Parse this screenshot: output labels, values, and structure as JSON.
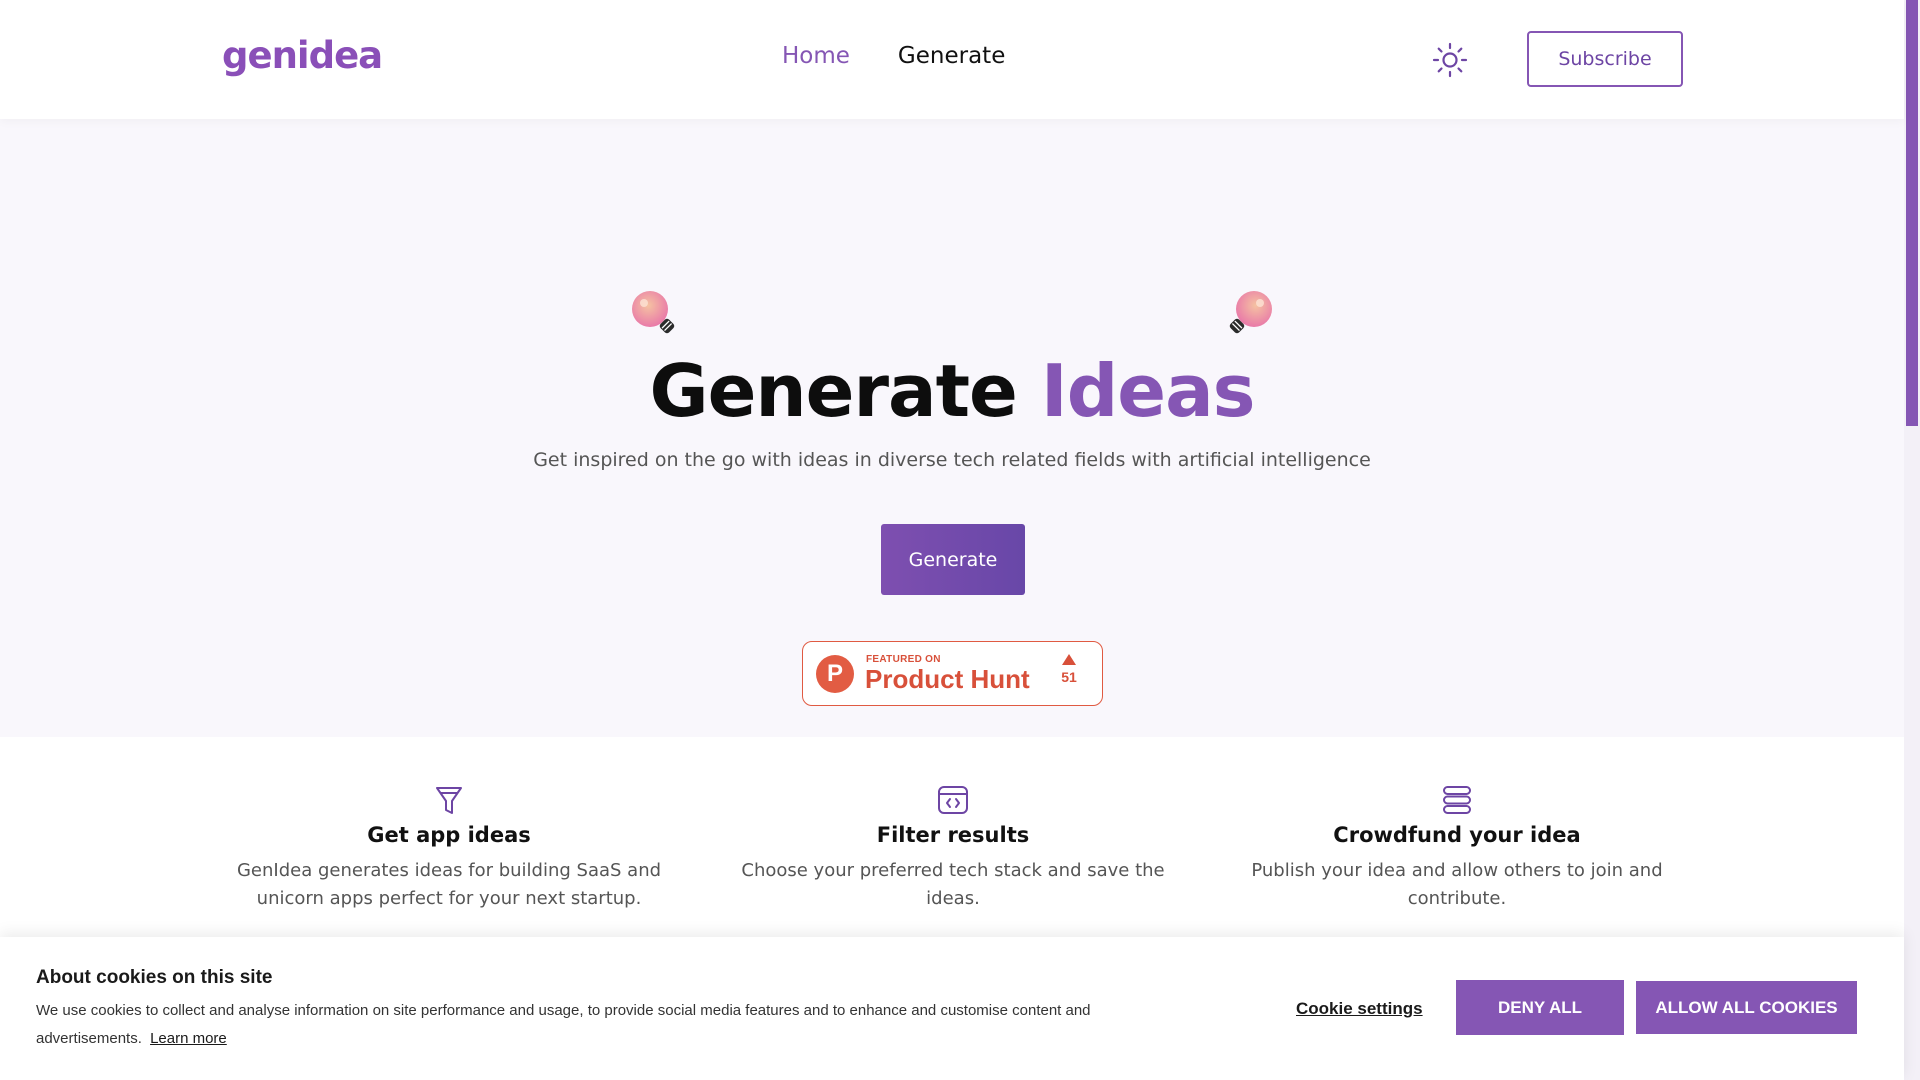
{
  "header": {
    "logo": "genidea",
    "nav": [
      {
        "label": "Home"
      },
      {
        "label": "Generate"
      }
    ],
    "subscribe_label": "Subscribe"
  },
  "hero": {
    "title_part1": "Generate",
    "title_part2": "Ideas",
    "subtitle": "Get inspired on the go with ideas in diverse tech related fields with artificial intelligence",
    "generate_label": "Generate",
    "product_hunt": {
      "featured": "FEATURED ON",
      "name": "Product Hunt",
      "upvotes": "51"
    }
  },
  "features": [
    {
      "icon": "funnel-icon",
      "title": "Get app ideas",
      "description": "GenIdea generates ideas for building SaaS and unicorn apps perfect for your next startup."
    },
    {
      "icon": "code-window-icon",
      "title": "Filter results",
      "description": "Choose your preferred tech stack and save the ideas."
    },
    {
      "icon": "stack-icon",
      "title": "Crowdfund your idea",
      "description": "Publish your idea and allow others to join and contribute."
    }
  ],
  "cookie_banner": {
    "title": "About cookies on this site",
    "text": "We use cookies to collect and analyse information on site performance and usage, to provide social media features and to enhance and customise content and advertisements.",
    "learn_more": "Learn more",
    "settings_label": "Cookie settings",
    "deny_label": "DENY ALL",
    "allow_label": "ALLOW ALL COOKIES"
  },
  "colors": {
    "accent": "#8556b4",
    "hero_bg": "#f9f7fc",
    "product_hunt": "#d8503a"
  }
}
